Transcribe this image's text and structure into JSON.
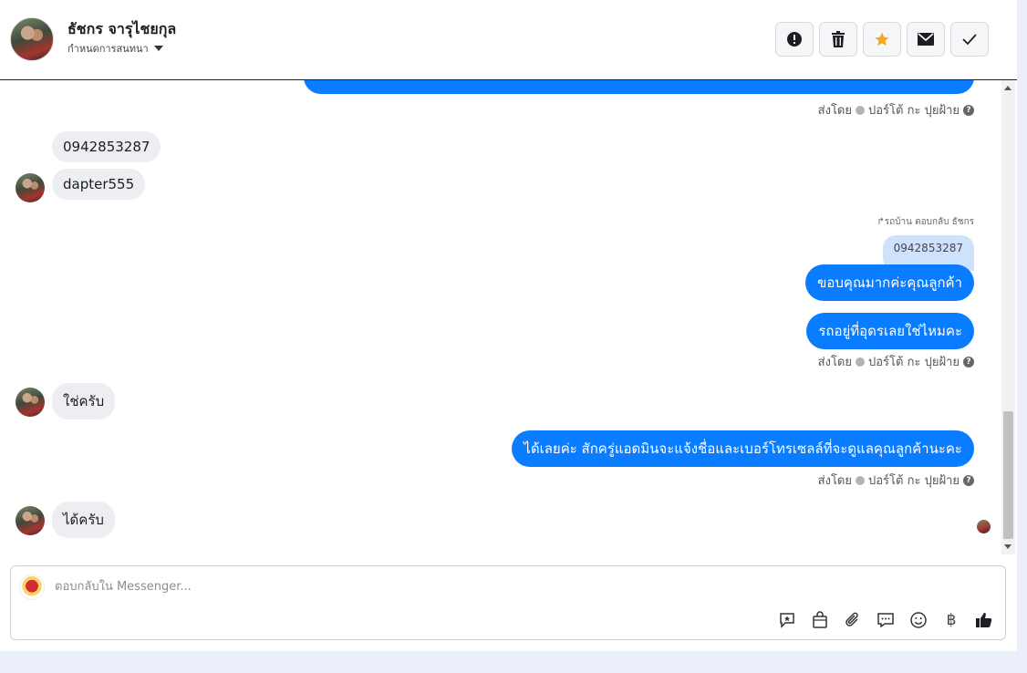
{
  "header": {
    "contact_name": "ธัชกร จารุไชยกุล",
    "assign_label": "กำหนดการสนทนา",
    "actions": [
      {
        "name": "report-button",
        "icon": "alert-icon"
      },
      {
        "name": "delete-button",
        "icon": "trash-icon"
      },
      {
        "name": "star-button",
        "icon": "star-icon"
      },
      {
        "name": "mark-unread-button",
        "icon": "envelope-icon"
      },
      {
        "name": "mark-done-button",
        "icon": "check-icon"
      }
    ]
  },
  "messages": {
    "sent_by_prefix": "ส่งโดย",
    "sent_by_name": "ปอร์โต้ กะ ปุยฝ้าย",
    "reply_note": "รถบ้าน ตอบกลับ ธัชกร",
    "quoted_text": "0942853287",
    "incoming_1": "0942853287",
    "incoming_2": "dapter555",
    "outgoing_1": "ขอบคุณมากค่ะคุณลูกค้า",
    "outgoing_2": "รถอยู่ที่อุดรเลยใช่ไหมคะ",
    "incoming_3": "ใช่ครับ",
    "outgoing_3": "ได้เลยค่ะ สักครู่แอดมินจะแจ้งชื่อและเบอร์โทรเซลล์ที่จะดูแลคุณลูกค้านะคะ",
    "incoming_4": "ได้ครับ"
  },
  "composer": {
    "placeholder": "ตอบกลับใน Messenger...",
    "tools": [
      "saved-reply-icon",
      "shop-bag-icon",
      "attachment-icon",
      "chat-bubbles-icon",
      "emoji-icon",
      "baht-icon",
      "thumbs-up-icon"
    ]
  },
  "colors": {
    "outgoing_bubble": "#0a7cff",
    "incoming_bubble": "#eceef1",
    "quoted_bubble": "#cfe2fb",
    "star": "#f5a623"
  }
}
